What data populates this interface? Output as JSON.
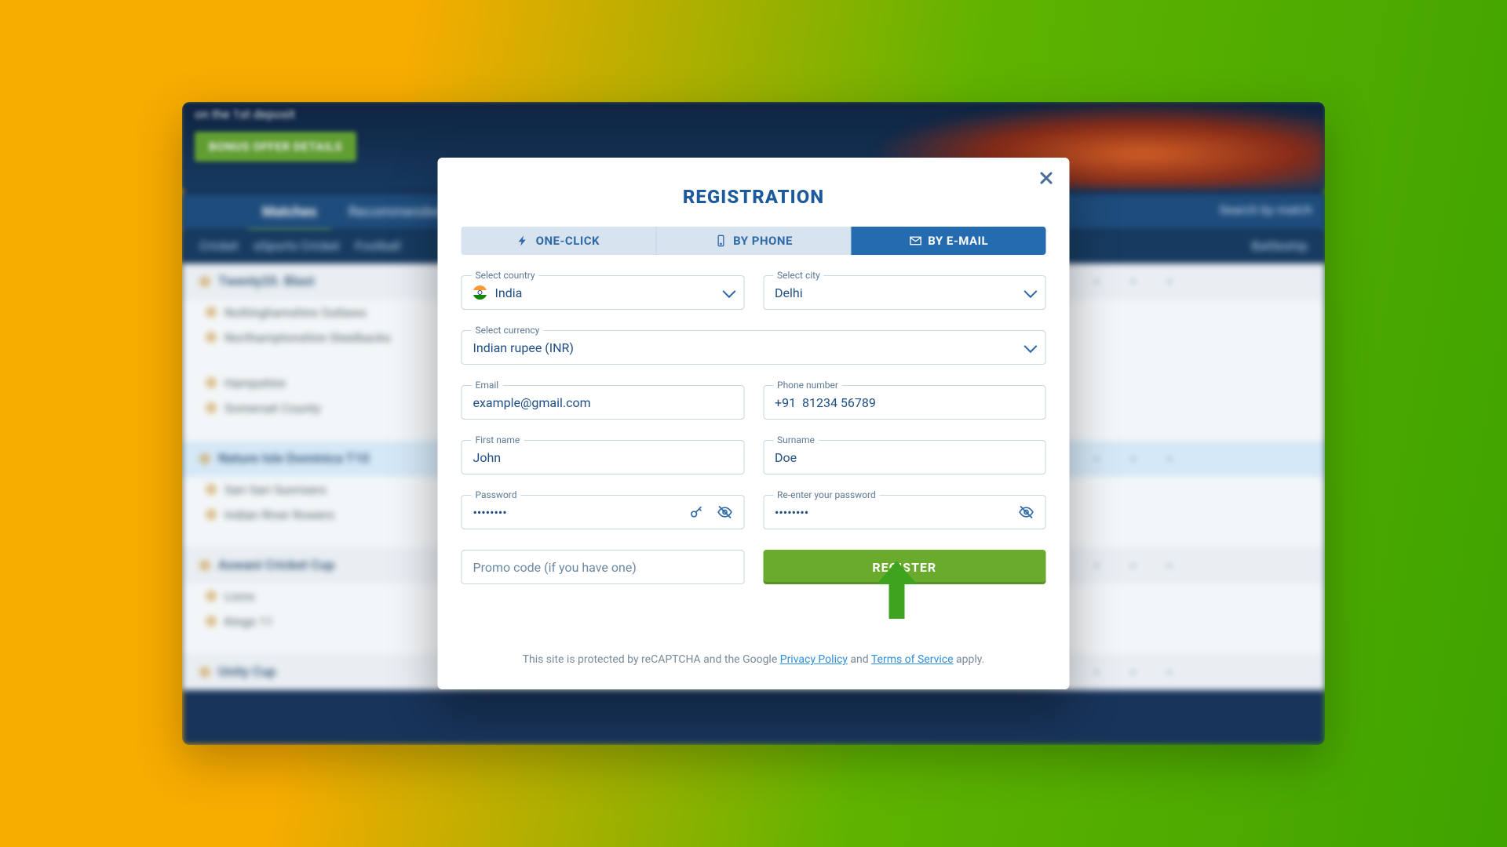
{
  "background": {
    "deposit_hint": "on the 1st deposit",
    "bonus_button": "BONUS OFFER DETAILS",
    "nav": {
      "matches": "Matches",
      "recommended": "Recommended"
    },
    "subnav": "Cricket     eSports Cricket     Football",
    "right_subnav": "Battleship",
    "search_placeholder": "Search by match",
    "rows": [
      "Twenty20. Blast",
      "Nottinghamshire Outlaws",
      "Northamptonshire Steelbacks",
      "Hampshire",
      "Somerset County",
      "Nature Isle Dominica T10",
      "Sari Sari Sunrisers",
      "Indian River Rowers",
      "Aswani Cricket Cup",
      "Lions",
      "Kings 11",
      "Unity Cup"
    ]
  },
  "modal": {
    "title": "REGISTRATION",
    "tabs": {
      "one_click": "ONE-CLICK",
      "by_phone": "BY PHONE",
      "by_email": "BY E-MAIL"
    },
    "country": {
      "label": "Select country",
      "value": "India"
    },
    "city": {
      "label": "Select city",
      "value": "Delhi"
    },
    "currency": {
      "label": "Select currency",
      "value": "Indian rupee (INR)"
    },
    "email": {
      "label": "Email",
      "value": "example@gmail.com"
    },
    "phone": {
      "label": "Phone number",
      "value": "+91  81234 56789"
    },
    "first": {
      "label": "First name",
      "value": "John"
    },
    "surname": {
      "label": "Surname",
      "value": "Doe"
    },
    "pass": {
      "label": "Password",
      "value": "••••••••"
    },
    "pass2": {
      "label": "Re-enter your password",
      "value": "••••••••"
    },
    "promo_placeholder": "Promo code (if you have one)",
    "register": "REGISTER",
    "footer": {
      "pre": "This site is protected by reCAPTCHA and the Google ",
      "pp": "Privacy Policy",
      "and": " and ",
      "tos": "Terms of Service",
      "post": " apply."
    }
  }
}
